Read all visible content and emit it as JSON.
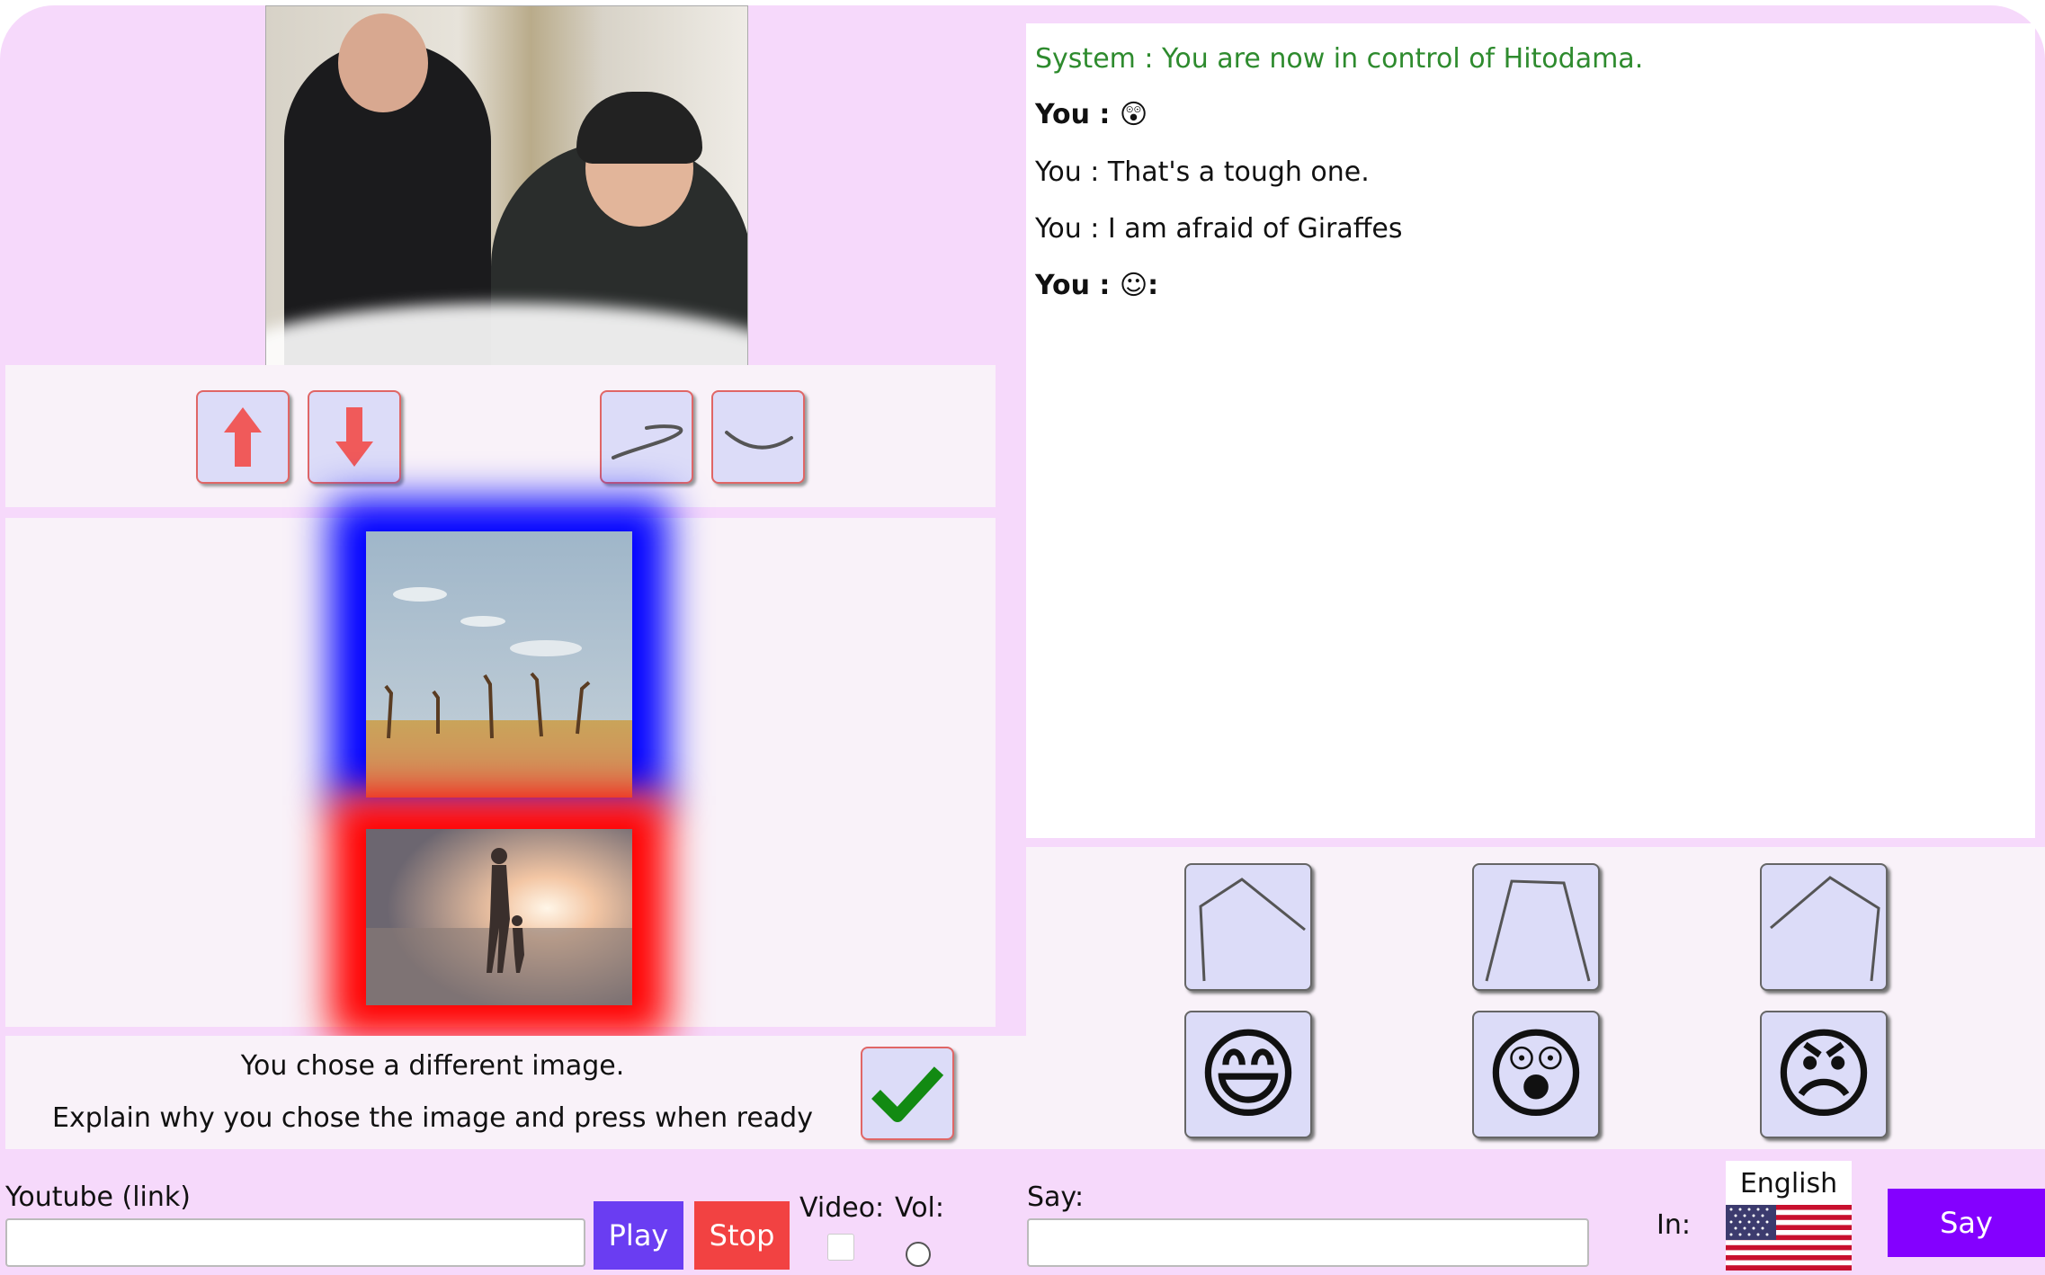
{
  "chat": {
    "messages": [
      {
        "text": "System : You are now in control of Hitodama.",
        "kind": "system"
      },
      {
        "text": "You : 😲",
        "kind": "bold"
      },
      {
        "text": "You : That's a tough one.",
        "kind": "normal"
      },
      {
        "text": "You : I am afraid of Giraffes",
        "kind": "normal"
      },
      {
        "text": "You : ☺:",
        "kind": "bold"
      }
    ]
  },
  "controls": {
    "head_buttons": [
      "arrow-up-icon",
      "arrow-down-icon",
      "mouth-tilt-icon",
      "mouth-smile-icon"
    ],
    "frame_colors": {
      "top": "#0000ff",
      "bottom": "#ff0000"
    }
  },
  "prompt": {
    "line1": "You chose a different image.",
    "line2": "Explain why you chose the image and press when ready"
  },
  "faces": {
    "eyebrows": [
      "eyebrow-pentagon-left-icon",
      "eyebrow-trapezoid-icon",
      "eyebrow-pentagon-right-icon"
    ],
    "emojis": [
      {
        "name": "grinning-face-icon",
        "glyph": "😄"
      },
      {
        "name": "astonished-face-icon",
        "glyph": "😲"
      },
      {
        "name": "angry-face-icon",
        "glyph": "😠"
      }
    ]
  },
  "bottom": {
    "youtube_label": "Youtube (link)",
    "youtube_value": "",
    "play_label": "Play",
    "stop_label": "Stop",
    "video_label": "Video:",
    "vol_label": "Vol:",
    "say_label": "Say:",
    "say_value": "",
    "in_label": "In:",
    "language": "English",
    "say_button": "Say"
  },
  "colors": {
    "background": "#f6d9fb",
    "panel": "#f9f2f9",
    "button_fill": "#dcdcf8",
    "system_text": "#2e8b2e",
    "play": "#6a3df2",
    "stop": "#f24242",
    "say": "#8400ff"
  }
}
